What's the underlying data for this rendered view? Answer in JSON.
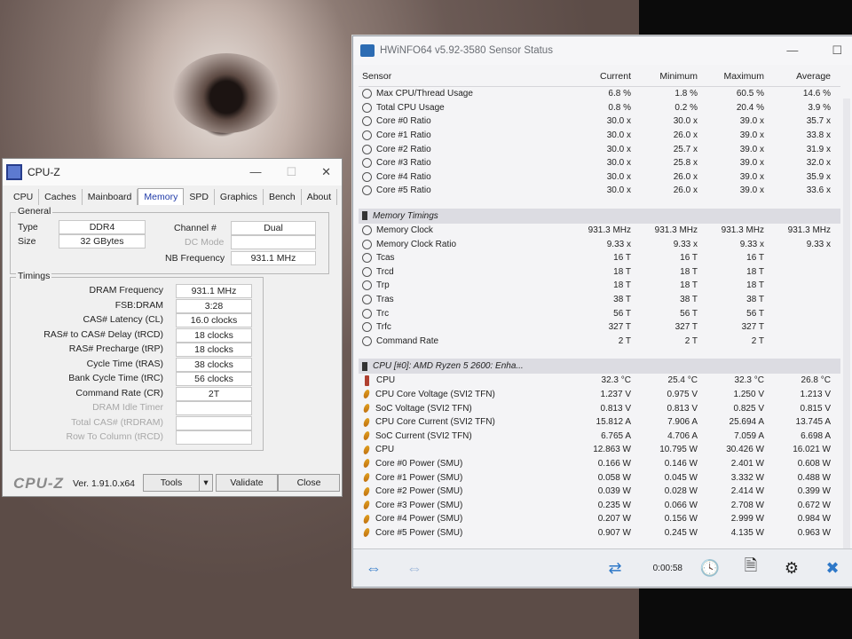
{
  "hwinfo": {
    "title": "HWiNFO64 v5.92-3580 Sensor Status",
    "columns": [
      "Sensor",
      "Current",
      "Minimum",
      "Maximum",
      "Average"
    ],
    "rows_top": [
      {
        "name": "Max CPU/Thread Usage",
        "cur": "6.8 %",
        "min": "1.8 %",
        "max": "60.5 %",
        "avg": "14.6 %"
      },
      {
        "name": "Total CPU Usage",
        "cur": "0.8 %",
        "min": "0.2 %",
        "max": "20.4 %",
        "avg": "3.9 %"
      },
      {
        "name": "Core #0 Ratio",
        "cur": "30.0 x",
        "min": "30.0 x",
        "max": "39.0 x",
        "avg": "35.7 x"
      },
      {
        "name": "Core #1 Ratio",
        "cur": "30.0 x",
        "min": "26.0 x",
        "max": "39.0 x",
        "avg": "33.8 x"
      },
      {
        "name": "Core #2 Ratio",
        "cur": "30.0 x",
        "min": "25.7 x",
        "max": "39.0 x",
        "avg": "31.9 x"
      },
      {
        "name": "Core #3 Ratio",
        "cur": "30.0 x",
        "min": "25.8 x",
        "max": "39.0 x",
        "avg": "32.0 x"
      },
      {
        "name": "Core #4 Ratio",
        "cur": "30.0 x",
        "min": "26.0 x",
        "max": "39.0 x",
        "avg": "35.9 x"
      },
      {
        "name": "Core #5 Ratio",
        "cur": "30.0 x",
        "min": "26.0 x",
        "max": "39.0 x",
        "avg": "33.6 x"
      }
    ],
    "group_mem": "Memory Timings",
    "rows_mem": [
      {
        "name": "Memory Clock",
        "cur": "931.3 MHz",
        "min": "931.3 MHz",
        "max": "931.3 MHz",
        "avg": "931.3 MHz"
      },
      {
        "name": "Memory Clock Ratio",
        "cur": "9.33 x",
        "min": "9.33 x",
        "max": "9.33 x",
        "avg": "9.33 x"
      },
      {
        "name": "Tcas",
        "cur": "16 T",
        "min": "16 T",
        "max": "16 T",
        "avg": ""
      },
      {
        "name": "Trcd",
        "cur": "18 T",
        "min": "18 T",
        "max": "18 T",
        "avg": ""
      },
      {
        "name": "Trp",
        "cur": "18 T",
        "min": "18 T",
        "max": "18 T",
        "avg": ""
      },
      {
        "name": "Tras",
        "cur": "38 T",
        "min": "38 T",
        "max": "38 T",
        "avg": ""
      },
      {
        "name": "Trc",
        "cur": "56 T",
        "min": "56 T",
        "max": "56 T",
        "avg": ""
      },
      {
        "name": "Trfc",
        "cur": "327 T",
        "min": "327 T",
        "max": "327 T",
        "avg": ""
      },
      {
        "name": "Command Rate",
        "cur": "2 T",
        "min": "2 T",
        "max": "2 T",
        "avg": ""
      }
    ],
    "group_cpu": "CPU [#0]: AMD Ryzen 5 2600: Enha...",
    "rows_cpu": [
      {
        "icon": "temp",
        "name": "CPU",
        "cur": "32.3 °C",
        "min": "25.4 °C",
        "max": "32.3 °C",
        "avg": "26.8 °C"
      },
      {
        "icon": "volt",
        "name": "CPU Core Voltage (SVI2 TFN)",
        "cur": "1.237 V",
        "min": "0.975 V",
        "max": "1.250 V",
        "avg": "1.213 V"
      },
      {
        "icon": "volt",
        "name": "SoC Voltage (SVI2 TFN)",
        "cur": "0.813 V",
        "min": "0.813 V",
        "max": "0.825 V",
        "avg": "0.815 V"
      },
      {
        "icon": "volt",
        "name": "CPU Core Current (SVI2 TFN)",
        "cur": "15.812 A",
        "min": "7.906 A",
        "max": "25.694 A",
        "avg": "13.745 A"
      },
      {
        "icon": "volt",
        "name": "SoC Current (SVI2 TFN)",
        "cur": "6.765 A",
        "min": "4.706 A",
        "max": "7.059 A",
        "avg": "6.698 A"
      },
      {
        "icon": "volt",
        "name": "CPU",
        "cur": "12.863 W",
        "min": "10.795 W",
        "max": "30.426 W",
        "avg": "16.021 W"
      },
      {
        "icon": "volt",
        "name": "Core #0 Power (SMU)",
        "cur": "0.166 W",
        "min": "0.146 W",
        "max": "2.401 W",
        "avg": "0.608 W"
      },
      {
        "icon": "volt",
        "name": "Core #1 Power (SMU)",
        "cur": "0.058 W",
        "min": "0.045 W",
        "max": "3.332 W",
        "avg": "0.488 W"
      },
      {
        "icon": "volt",
        "name": "Core #2 Power (SMU)",
        "cur": "0.039 W",
        "min": "0.028 W",
        "max": "2.414 W",
        "avg": "0.399 W"
      },
      {
        "icon": "volt",
        "name": "Core #3 Power (SMU)",
        "cur": "0.235 W",
        "min": "0.066 W",
        "max": "2.708 W",
        "avg": "0.672 W"
      },
      {
        "icon": "volt",
        "name": "Core #4 Power (SMU)",
        "cur": "0.207 W",
        "min": "0.156 W",
        "max": "2.999 W",
        "avg": "0.984 W"
      },
      {
        "icon": "volt",
        "name": "Core #5 Power (SMU)",
        "cur": "0.907 W",
        "min": "0.245 W",
        "max": "4.135 W",
        "avg": "0.963 W"
      }
    ],
    "timer": "0:00:58"
  },
  "cpuz": {
    "title": "CPU-Z",
    "tabs": [
      "CPU",
      "Caches",
      "Mainboard",
      "Memory",
      "SPD",
      "Graphics",
      "Bench",
      "About"
    ],
    "active_tab": "Memory",
    "general_legend": "General",
    "type_label": "Type",
    "type_value": "DDR4",
    "size_label": "Size",
    "size_value": "32 GBytes",
    "channel_label": "Channel #",
    "channel_value": "Dual",
    "dcmode_label": "DC Mode",
    "dcmode_value": "",
    "nbfreq_label": "NB Frequency",
    "nbfreq_value": "931.1 MHz",
    "timings_legend": "Timings",
    "timings": [
      {
        "label": "DRAM Frequency",
        "value": "931.1 MHz",
        "grey": false
      },
      {
        "label": "FSB:DRAM",
        "value": "3:28",
        "grey": false
      },
      {
        "label": "CAS# Latency (CL)",
        "value": "16.0 clocks",
        "grey": false
      },
      {
        "label": "RAS# to CAS# Delay (tRCD)",
        "value": "18 clocks",
        "grey": false
      },
      {
        "label": "RAS# Precharge (tRP)",
        "value": "18 clocks",
        "grey": false
      },
      {
        "label": "Cycle Time (tRAS)",
        "value": "38 clocks",
        "grey": false
      },
      {
        "label": "Bank Cycle Time (tRC)",
        "value": "56 clocks",
        "grey": false
      },
      {
        "label": "Command Rate (CR)",
        "value": "2T",
        "grey": false
      },
      {
        "label": "DRAM Idle Timer",
        "value": "",
        "grey": true
      },
      {
        "label": "Total CAS# (tRDRAM)",
        "value": "",
        "grey": true
      },
      {
        "label": "Row To Column (tRCD)",
        "value": "",
        "grey": true
      }
    ],
    "brand": "CPU-Z",
    "version": "Ver. 1.91.0.x64",
    "tools_label": "Tools",
    "validate_label": "Validate",
    "close_label": "Close"
  }
}
